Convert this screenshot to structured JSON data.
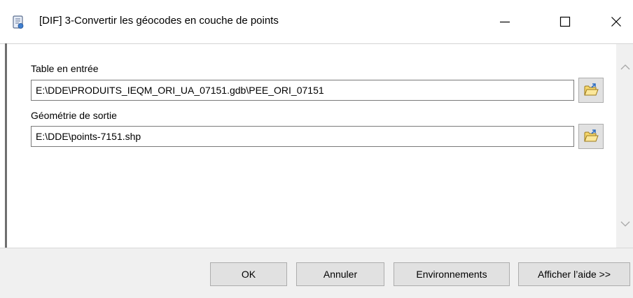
{
  "window": {
    "title": "[DIF] 3-Convertir les géocodes en couche de points",
    "icon": "script-tool-icon"
  },
  "form": {
    "input_table": {
      "label": "Table en entrée",
      "value": "E:\\DDE\\PRODUITS_IEQM_ORI_UA_07151.gdb\\PEE_ORI_07151",
      "browse_icon": "open-folder-icon"
    },
    "output_geometry": {
      "label": "Géométrie de sortie",
      "value": "E:\\DDE\\points-7151.shp",
      "browse_icon": "open-folder-icon"
    }
  },
  "buttons": {
    "ok": "OK",
    "cancel": "Annuler",
    "environments": "Environnements",
    "show_help": "Afficher l’aide >>"
  },
  "colors": {
    "folder_fill": "#f5d66b",
    "folder_stroke": "#9c7a1c",
    "arrow": "#2f6fc4"
  }
}
